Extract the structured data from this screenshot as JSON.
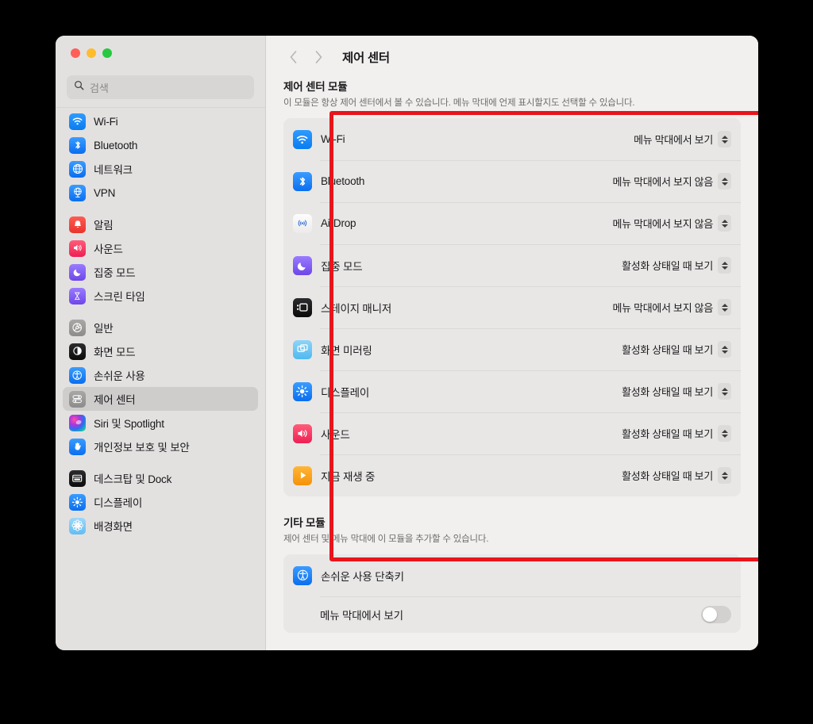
{
  "window": {
    "traffic_lights": [
      "close",
      "minimize",
      "zoom"
    ]
  },
  "sidebar": {
    "search": {
      "placeholder": "검색",
      "value": "",
      "icon": "search-icon"
    },
    "groups": [
      {
        "items": [
          {
            "label": "Wi-Fi",
            "icon": "wifi-icon",
            "selected": false
          },
          {
            "label": "Bluetooth",
            "icon": "bluetooth-icon",
            "selected": false
          },
          {
            "label": "네트워크",
            "icon": "network-globe-icon",
            "selected": false
          },
          {
            "label": "VPN",
            "icon": "vpn-icon",
            "selected": false
          }
        ]
      },
      {
        "items": [
          {
            "label": "알림",
            "icon": "notifications-bell-icon",
            "selected": false
          },
          {
            "label": "사운드",
            "icon": "sound-speaker-icon",
            "selected": false
          },
          {
            "label": "집중 모드",
            "icon": "focus-moon-icon",
            "selected": false
          },
          {
            "label": "스크린 타임",
            "icon": "screen-time-hourglass-icon",
            "selected": false
          }
        ]
      },
      {
        "items": [
          {
            "label": "일반",
            "icon": "general-gear-icon",
            "selected": false
          },
          {
            "label": "화면 모드",
            "icon": "appearance-contrast-icon",
            "selected": false
          },
          {
            "label": "손쉬운 사용",
            "icon": "accessibility-icon",
            "selected": false
          },
          {
            "label": "제어 센터",
            "icon": "control-center-icon",
            "selected": true
          },
          {
            "label": "Siri 및 Spotlight",
            "icon": "siri-icon",
            "selected": false
          },
          {
            "label": "개인정보 보호 및 보안",
            "icon": "privacy-hand-icon",
            "selected": false
          }
        ]
      },
      {
        "items": [
          {
            "label": "데스크탑 및 Dock",
            "icon": "desktop-dock-icon",
            "selected": false
          },
          {
            "label": "디스플레이",
            "icon": "display-brightness-icon",
            "selected": false
          },
          {
            "label": "배경화면",
            "icon": "wallpaper-flower-icon",
            "selected": false
          }
        ]
      }
    ]
  },
  "toolbar": {
    "back_label": "‹",
    "forward_label": "›",
    "title": "제어 센터"
  },
  "main": {
    "section1": {
      "title": "제어 센터 모듈",
      "description": "이 모듈은 항상 제어 센터에서 볼 수 있습니다. 메뉴 막대에 언제 표시할지도 선택할 수 있습니다.",
      "rows": [
        {
          "label": "Wi-Fi",
          "icon": "wifi-icon",
          "value": "메뉴 막대에서 보기"
        },
        {
          "label": "Bluetooth",
          "icon": "bluetooth-icon",
          "value": "메뉴 막대에서 보지 않음"
        },
        {
          "label": "AirDrop",
          "icon": "airdrop-icon",
          "value": "메뉴 막대에서 보지 않음"
        },
        {
          "label": "집중 모드",
          "icon": "focus-moon-icon",
          "value": "활성화 상태일 때 보기"
        },
        {
          "label": "스테이지 매니저",
          "icon": "stage-manager-icon",
          "value": "메뉴 막대에서 보지 않음"
        },
        {
          "label": "화면 미러링",
          "icon": "screen-mirroring-icon",
          "value": "활성화 상태일 때 보기"
        },
        {
          "label": "디스플레이",
          "icon": "display-brightness-icon",
          "value": "활성화 상태일 때 보기"
        },
        {
          "label": "사운드",
          "icon": "sound-speaker-icon",
          "value": "활성화 상태일 때 보기"
        },
        {
          "label": "지금 재생 중",
          "icon": "now-playing-icon",
          "value": "활성화 상태일 때 보기"
        }
      ]
    },
    "section2": {
      "title": "기타 모듈",
      "description": "제어 센터 및 메뉴 막대에 이 모듈을 추가할 수 있습니다.",
      "rows": [
        {
          "label": "손쉬운 사용 단축키",
          "icon": "accessibility-icon"
        }
      ],
      "sub_rows": [
        {
          "label": "메뉴 막대에서 보기",
          "toggle_on": false
        }
      ]
    }
  },
  "annotation": {
    "highlight_color": "#e8151b",
    "target": "제어 센터 모듈"
  }
}
